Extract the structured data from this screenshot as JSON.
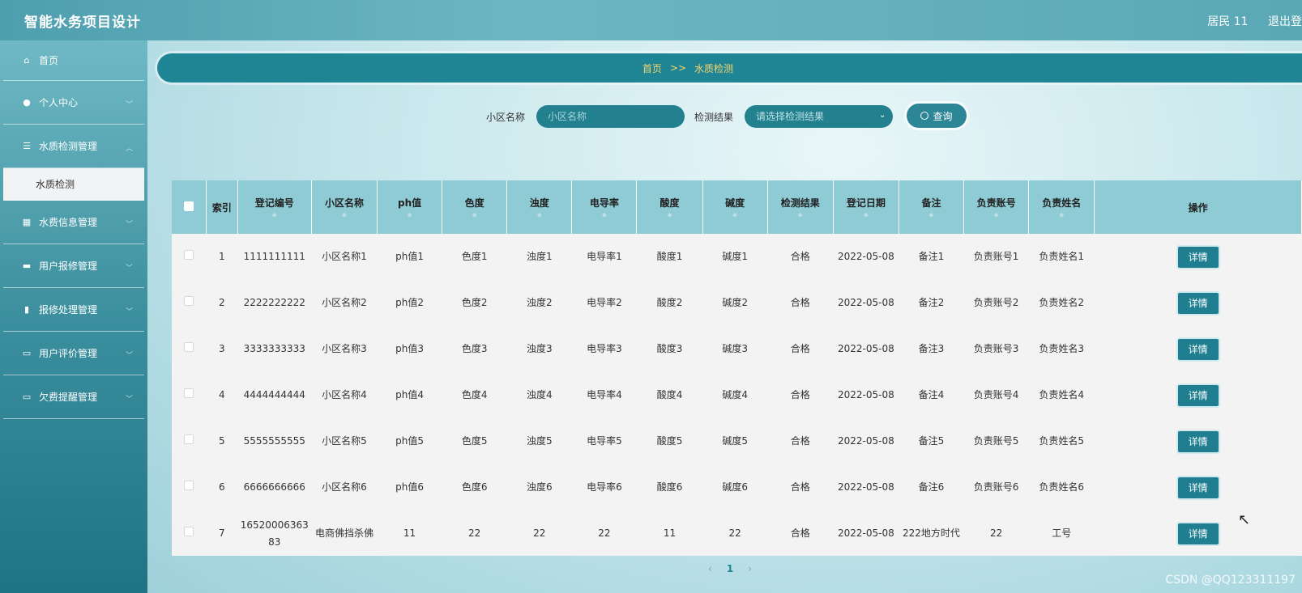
{
  "app": {
    "title": "智能水务项目设计",
    "user": "居民 11",
    "logout": "退出登"
  },
  "sidebar": {
    "items": [
      {
        "label": "首页",
        "icon": "home-icon"
      },
      {
        "label": "个人中心",
        "icon": "user-icon"
      },
      {
        "label": "水质检测管理",
        "icon": "list-icon"
      },
      {
        "label": "水费信息管理",
        "icon": "grid-icon"
      },
      {
        "label": "用户报修管理",
        "icon": "ticket-icon"
      },
      {
        "label": "报修处理管理",
        "icon": "bar-chart-icon"
      },
      {
        "label": "用户评价管理",
        "icon": "card-icon"
      },
      {
        "label": "欠费提醒管理",
        "icon": "card-icon"
      }
    ],
    "active_sub": "水质检测"
  },
  "breadcrumb": {
    "home": "首页",
    "sep": ">>",
    "current": "水质检测"
  },
  "search": {
    "community_label": "小区名称",
    "community_placeholder": "小区名称",
    "result_label": "检测结果",
    "result_placeholder": "请选择检测结果",
    "query_button": "查询"
  },
  "table": {
    "headers": [
      "索引",
      "登记编号",
      "小区名称",
      "ph值",
      "色度",
      "浊度",
      "电导率",
      "酸度",
      "碱度",
      "检测结果",
      "登记日期",
      "备注",
      "负责账号",
      "负责姓名",
      "操作"
    ],
    "rows": [
      [
        "1",
        "1111111111",
        "小区名称1",
        "ph值1",
        "色度1",
        "浊度1",
        "电导率1",
        "酸度1",
        "碱度1",
        "合格",
        "2022-05-08",
        "备注1",
        "负责账号1",
        "负责姓名1"
      ],
      [
        "2",
        "2222222222",
        "小区名称2",
        "ph值2",
        "色度2",
        "浊度2",
        "电导率2",
        "酸度2",
        "碱度2",
        "合格",
        "2022-05-08",
        "备注2",
        "负责账号2",
        "负责姓名2"
      ],
      [
        "3",
        "3333333333",
        "小区名称3",
        "ph值3",
        "色度3",
        "浊度3",
        "电导率3",
        "酸度3",
        "碱度3",
        "合格",
        "2022-05-08",
        "备注3",
        "负责账号3",
        "负责姓名3"
      ],
      [
        "4",
        "4444444444",
        "小区名称4",
        "ph值4",
        "色度4",
        "浊度4",
        "电导率4",
        "酸度4",
        "碱度4",
        "合格",
        "2022-05-08",
        "备注4",
        "负责账号4",
        "负责姓名4"
      ],
      [
        "5",
        "5555555555",
        "小区名称5",
        "ph值5",
        "色度5",
        "浊度5",
        "电导率5",
        "酸度5",
        "碱度5",
        "合格",
        "2022-05-08",
        "备注5",
        "负责账号5",
        "负责姓名5"
      ],
      [
        "6",
        "6666666666",
        "小区名称6",
        "ph值6",
        "色度6",
        "浊度6",
        "电导率6",
        "酸度6",
        "碱度6",
        "合格",
        "2022-05-08",
        "备注6",
        "负责账号6",
        "负责姓名6"
      ],
      [
        "7",
        "1652000636383",
        "电商佛挡杀佛",
        "11",
        "22",
        "22",
        "22",
        "11",
        "22",
        "合格",
        "2022-05-08",
        "222地方时代",
        "22",
        "工号"
      ]
    ],
    "detail_button": "详情"
  },
  "pagination": {
    "prev": "‹",
    "current": "1",
    "next": "›"
  },
  "watermark": "CSDN @QQ123311197",
  "colors": {
    "accent": "#1f8494",
    "breadcrumb_text": "#f5d76e",
    "header_bg": "#8fcbd4"
  }
}
